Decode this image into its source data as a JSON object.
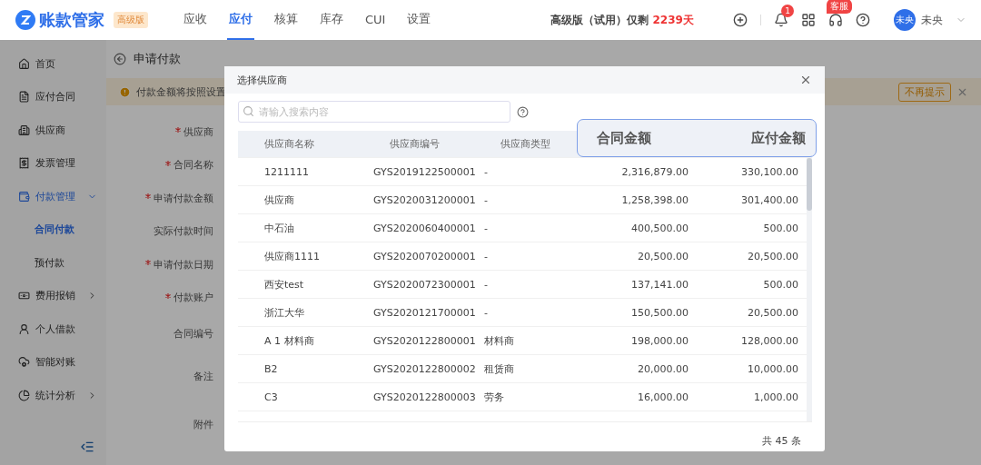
{
  "top_bar": {
    "logo": {
      "name": "账款管家",
      "badge": "高级版"
    },
    "nav": [
      {
        "label": "应收",
        "selected": false
      },
      {
        "label": "应付",
        "selected": true
      },
      {
        "label": "核算",
        "selected": false
      },
      {
        "label": "库存",
        "selected": false
      },
      {
        "label": "CUI",
        "selected": false
      },
      {
        "label": "设置",
        "selected": false
      }
    ],
    "trial": {
      "text": "高级版（试用）仅剩",
      "days": "2239天"
    },
    "notification_count": "1",
    "service_badge": "客服",
    "user": {
      "avatar": "未央",
      "name": "未央"
    }
  },
  "sidebar": {
    "items": [
      {
        "label": "首页",
        "selected": false
      },
      {
        "label": "应付合同",
        "selected": false
      },
      {
        "label": "供应商",
        "selected": false
      },
      {
        "label": "发票管理",
        "selected": false
      },
      {
        "label": "付款管理",
        "selected": true,
        "expanded": true,
        "children": [
          {
            "label": "合同付款",
            "selected": true
          },
          {
            "label": "预付款",
            "selected": false
          }
        ]
      },
      {
        "label": "费用报销",
        "selected": false,
        "expanded": false
      },
      {
        "label": "个人借款",
        "selected": false
      },
      {
        "label": "智能对账",
        "selected": false
      },
      {
        "label": "统计分析",
        "selected": false,
        "expanded": false
      }
    ]
  },
  "page": {
    "title": "申请付款",
    "notice": {
      "text": "付款金额将按照设置",
      "dismiss": "不再提示"
    },
    "form": [
      {
        "label": "供应商",
        "required": true
      },
      {
        "label": "合同名称",
        "required": true
      },
      {
        "label": "申请付款金额",
        "required": true
      },
      {
        "label": "实际付款时间",
        "required": false
      },
      {
        "label": "申请付款日期",
        "required": true
      },
      {
        "label": "付款账户",
        "required": true
      },
      {
        "label": "合同编号",
        "required": false
      },
      {
        "label": "备注",
        "required": false
      },
      {
        "label": "附件",
        "required": false
      }
    ]
  },
  "dialog": {
    "title": "选择供应商",
    "search": {
      "placeholder": "请输入搜索内容"
    },
    "columns": [
      "供应商名称",
      "供应商编号",
      "供应商类型",
      "合同金额",
      "应付金额"
    ],
    "rows": [
      {
        "name": "1211111",
        "code": "GYS2019122500001",
        "type": "-",
        "contract_amount": "2,316,879.00",
        "payable_amount": "330,100.00"
      },
      {
        "name": "供应商",
        "code": "GYS2020031200001",
        "type": "-",
        "contract_amount": "1,258,398.00",
        "payable_amount": "301,400.00"
      },
      {
        "name": "中石油",
        "code": "GYS2020060400001",
        "type": "-",
        "contract_amount": "400,500.00",
        "payable_amount": "500.00"
      },
      {
        "name": "供应商1111",
        "code": "GYS2020070200001",
        "type": "-",
        "contract_amount": "20,500.00",
        "payable_amount": "20,500.00"
      },
      {
        "name": "西安test",
        "code": "GYS2020072300001",
        "type": "-",
        "contract_amount": "137,141.00",
        "payable_amount": "500.00"
      },
      {
        "name": "浙江大华",
        "code": "GYS2020121700001",
        "type": "-",
        "contract_amount": "150,500.00",
        "payable_amount": "20,500.00"
      },
      {
        "name": "A 1 材料商",
        "code": "GYS2020122800001",
        "type": "材料商",
        "contract_amount": "198,000.00",
        "payable_amount": "128,000.00"
      },
      {
        "name": "B2",
        "code": "GYS2020122800002",
        "type": "租赁商",
        "contract_amount": "20,000.00",
        "payable_amount": "10,000.00"
      },
      {
        "name": "C3",
        "code": "GYS2020122800003",
        "type": "劳务",
        "contract_amount": "16,000.00",
        "payable_amount": "1,000.00"
      }
    ],
    "total": "共 45 条"
  }
}
